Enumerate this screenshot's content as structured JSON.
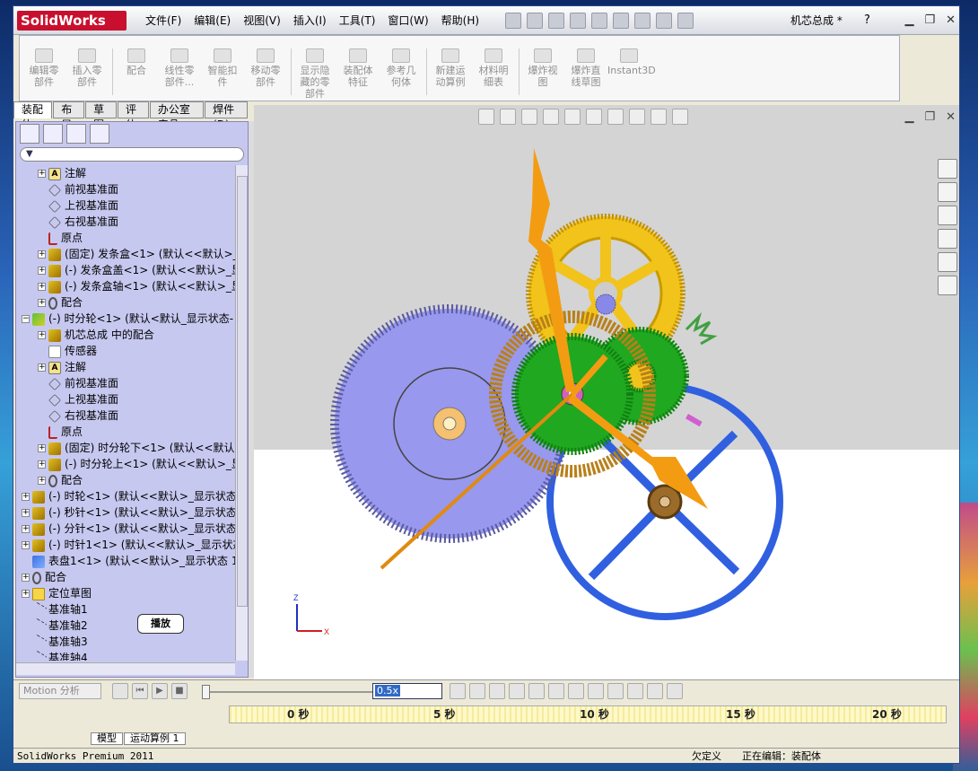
{
  "app": {
    "logo": "SolidWorks",
    "doc_title": "机芯总成 *",
    "help": "?"
  },
  "menu": [
    "文件(F)",
    "编辑(E)",
    "视图(V)",
    "插入(I)",
    "工具(T)",
    "窗口(W)",
    "帮助(H)"
  ],
  "command_manager": [
    {
      "label": "编辑零\n部件"
    },
    {
      "label": "插入零\n部件"
    },
    {
      "label": "配合"
    },
    {
      "label": "线性零\n部件..."
    },
    {
      "label": "智能扣\n件"
    },
    {
      "label": "移动零\n部件"
    },
    {
      "label": "显示隐\n藏的零\n部件"
    },
    {
      "label": "装配体\n特征"
    },
    {
      "label": "参考几\n何体"
    },
    {
      "label": "新建运\n动算例"
    },
    {
      "label": "材料明\n细表"
    },
    {
      "label": "爆炸视\n图"
    },
    {
      "label": "爆炸直\n线草图"
    },
    {
      "label": "Instant3D"
    }
  ],
  "tabs": [
    "装配体",
    "布局",
    "草图",
    "评估",
    "办公室产品",
    "焊件(D)"
  ],
  "tree": [
    {
      "indent": 1,
      "exp": "+",
      "icon": "note",
      "text": "注解"
    },
    {
      "indent": 1,
      "exp": "",
      "icon": "plane",
      "text": "前视基准面"
    },
    {
      "indent": 1,
      "exp": "",
      "icon": "plane",
      "text": "上视基准面"
    },
    {
      "indent": 1,
      "exp": "",
      "icon": "plane",
      "text": "右视基准面"
    },
    {
      "indent": 1,
      "exp": "",
      "icon": "orig",
      "text": "原点"
    },
    {
      "indent": 1,
      "exp": "+",
      "icon": "part",
      "text": "(固定) 发条盒<1> (默认<<默认>_"
    },
    {
      "indent": 1,
      "exp": "+",
      "icon": "part",
      "text": "(-) 发条盒盖<1> (默认<<默认>_显"
    },
    {
      "indent": 1,
      "exp": "+",
      "icon": "part",
      "text": "(-) 发条盒轴<1> (默认<<默认>_显"
    },
    {
      "indent": 1,
      "exp": "+",
      "icon": "mate",
      "text": "配合"
    },
    {
      "indent": 0,
      "exp": "−",
      "icon": "asm",
      "text": "(-) 时分轮<1> (默认<默认_显示状态-"
    },
    {
      "indent": 1,
      "exp": "+",
      "icon": "part",
      "text": "机芯总成 中的配合"
    },
    {
      "indent": 1,
      "exp": "",
      "icon": "sens",
      "text": "传感器"
    },
    {
      "indent": 1,
      "exp": "+",
      "icon": "note",
      "text": "注解"
    },
    {
      "indent": 1,
      "exp": "",
      "icon": "plane",
      "text": "前视基准面"
    },
    {
      "indent": 1,
      "exp": "",
      "icon": "plane",
      "text": "上视基准面"
    },
    {
      "indent": 1,
      "exp": "",
      "icon": "plane",
      "text": "右视基准面"
    },
    {
      "indent": 1,
      "exp": "",
      "icon": "orig",
      "text": "原点"
    },
    {
      "indent": 1,
      "exp": "+",
      "icon": "part",
      "text": "(固定) 时分轮下<1> (默认<<默认"
    },
    {
      "indent": 1,
      "exp": "+",
      "icon": "part",
      "text": "(-) 时分轮上<1> (默认<<默认>_显"
    },
    {
      "indent": 1,
      "exp": "+",
      "icon": "mate",
      "text": "配合"
    },
    {
      "indent": 0,
      "exp": "+",
      "icon": "part",
      "text": "(-) 时轮<1> (默认<<默认>_显示状态"
    },
    {
      "indent": 0,
      "exp": "+",
      "icon": "part",
      "text": "(-) 秒针<1> (默认<<默认>_显示状态"
    },
    {
      "indent": 0,
      "exp": "+",
      "icon": "part",
      "text": "(-) 分针<1> (默认<<默认>_显示状态"
    },
    {
      "indent": 0,
      "exp": "+",
      "icon": "part",
      "text": "(-) 时针1<1> (默认<<默认>_显示状态"
    },
    {
      "indent": 0,
      "exp": "",
      "icon": "blue",
      "text": "表盘1<1> (默认<<默认>_显示状态 1>"
    },
    {
      "indent": 0,
      "exp": "+",
      "icon": "mate",
      "text": "配合"
    },
    {
      "indent": 0,
      "exp": "+",
      "icon": "fold",
      "text": "定位草图"
    },
    {
      "indent": 0,
      "exp": "",
      "icon": "axis",
      "text": "基准轴1"
    },
    {
      "indent": 0,
      "exp": "",
      "icon": "axis",
      "text": "基准轴2"
    },
    {
      "indent": 0,
      "exp": "",
      "icon": "axis",
      "text": "基准轴3"
    },
    {
      "indent": 0,
      "exp": "",
      "icon": "axis",
      "text": "基准轴4"
    }
  ],
  "motion": {
    "study_type": "Motion 分析",
    "speed": "0.5x",
    "tooltip": "播放",
    "ticks": [
      "0 秒",
      "5 秒",
      "10 秒",
      "15 秒",
      "20 秒"
    ],
    "tabs": [
      "模型",
      "运动算例 1"
    ]
  },
  "status": {
    "product": "SolidWorks Premium 2011",
    "state": "欠定义",
    "editing": "正在编辑：装配体"
  },
  "axes": {
    "z": "Z",
    "x": "X"
  }
}
